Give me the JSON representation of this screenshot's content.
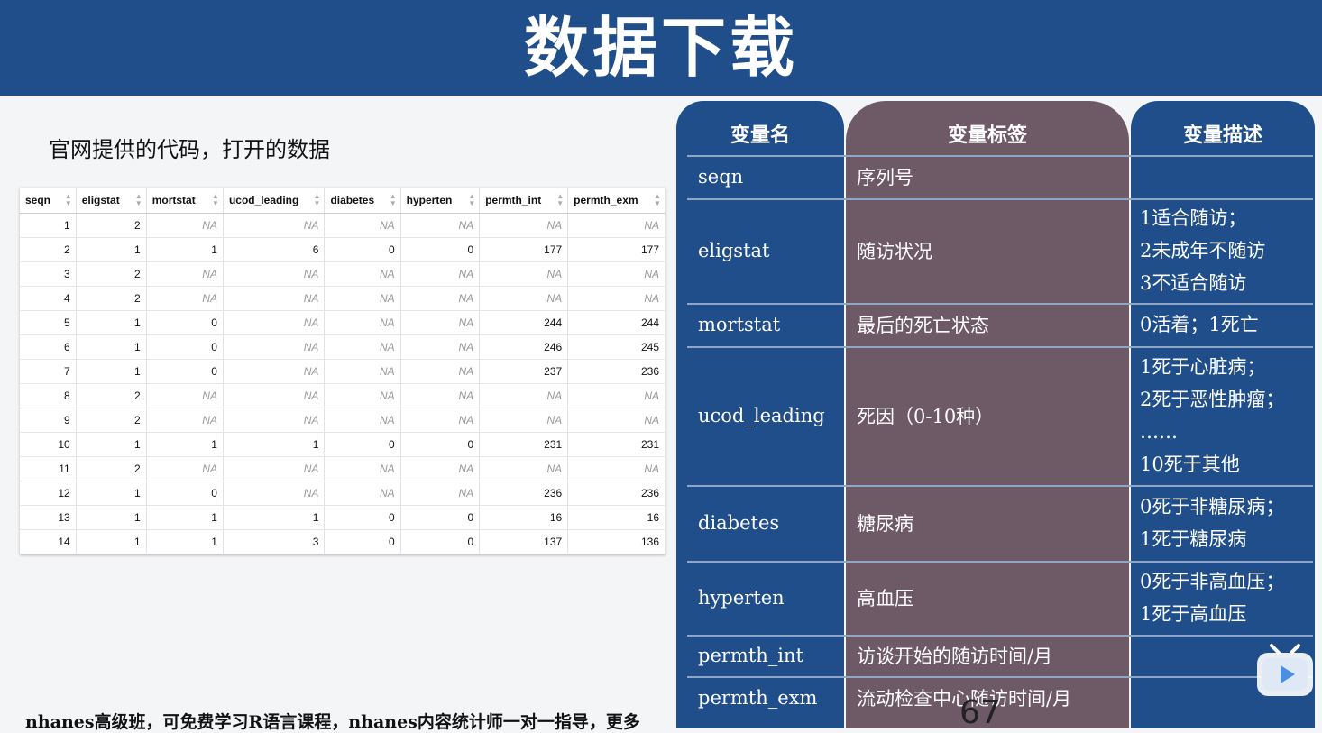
{
  "slide": {
    "title": "数据下载",
    "caption": "官网提供的代码，打开的数据",
    "page_number": "67",
    "footer": "nhanes高级班，可免费学习R语言课程，nhanes内容统计师一对一指导，更多"
  },
  "table": {
    "columns": [
      "seqn",
      "eligstat",
      "mortstat",
      "ucod_leading",
      "diabetes",
      "hyperten",
      "permth_int",
      "permth_exm"
    ],
    "rows": [
      [
        "1",
        "2",
        "NA",
        "NA",
        "NA",
        "NA",
        "NA",
        "NA"
      ],
      [
        "2",
        "1",
        "1",
        "6",
        "0",
        "0",
        "177",
        "177"
      ],
      [
        "3",
        "2",
        "NA",
        "NA",
        "NA",
        "NA",
        "NA",
        "NA"
      ],
      [
        "4",
        "2",
        "NA",
        "NA",
        "NA",
        "NA",
        "NA",
        "NA"
      ],
      [
        "5",
        "1",
        "0",
        "NA",
        "NA",
        "NA",
        "244",
        "244"
      ],
      [
        "6",
        "1",
        "0",
        "NA",
        "NA",
        "NA",
        "246",
        "245"
      ],
      [
        "7",
        "1",
        "0",
        "NA",
        "NA",
        "NA",
        "237",
        "236"
      ],
      [
        "8",
        "2",
        "NA",
        "NA",
        "NA",
        "NA",
        "NA",
        "NA"
      ],
      [
        "9",
        "2",
        "NA",
        "NA",
        "NA",
        "NA",
        "NA",
        "NA"
      ],
      [
        "10",
        "1",
        "1",
        "1",
        "0",
        "0",
        "231",
        "231"
      ],
      [
        "11",
        "2",
        "NA",
        "NA",
        "NA",
        "NA",
        "NA",
        "NA"
      ],
      [
        "12",
        "1",
        "0",
        "NA",
        "NA",
        "NA",
        "236",
        "236"
      ],
      [
        "13",
        "1",
        "1",
        "1",
        "0",
        "0",
        "16",
        "16"
      ],
      [
        "14",
        "1",
        "1",
        "3",
        "0",
        "0",
        "137",
        "136"
      ]
    ]
  },
  "dictionary": {
    "headers": {
      "name": "变量名",
      "label": "变量标签",
      "desc": "变量描述"
    },
    "rows": [
      {
        "name": "seqn",
        "label": "序列号",
        "desc": []
      },
      {
        "name": "eligstat",
        "label": "随访状况",
        "desc": [
          "1适合随访；",
          "2未成年不随访",
          "3不适合随访"
        ]
      },
      {
        "name": "mortstat",
        "label": "最后的死亡状态",
        "desc": [
          "0活着；1死亡"
        ]
      },
      {
        "name": "ucod_leading",
        "label": "死因（0-10种）",
        "desc": [
          "1死于心脏病；",
          "2死于恶性肿瘤；",
          "……",
          "10死于其他"
        ]
      },
      {
        "name": "diabetes",
        "label": "糖尿病",
        "desc": [
          "0死于非糖尿病；",
          "1死于糖尿病"
        ]
      },
      {
        "name": "hyperten",
        "label": "高血压",
        "desc": [
          "0死于非高血压；",
          "1死于高血压"
        ]
      },
      {
        "name": "permth_int",
        "label": "访谈开始的随访时间/月",
        "desc": []
      },
      {
        "name": "permth_exm",
        "label": "流动检查中心随访时间/月",
        "desc": []
      }
    ]
  },
  "colors": {
    "banner": "#1f4e8a",
    "label_column": "#6e5966",
    "na_text": "#9a9a9a"
  },
  "icons": {
    "sort": "sort-arrows-icon",
    "video": "tv-play-icon"
  }
}
